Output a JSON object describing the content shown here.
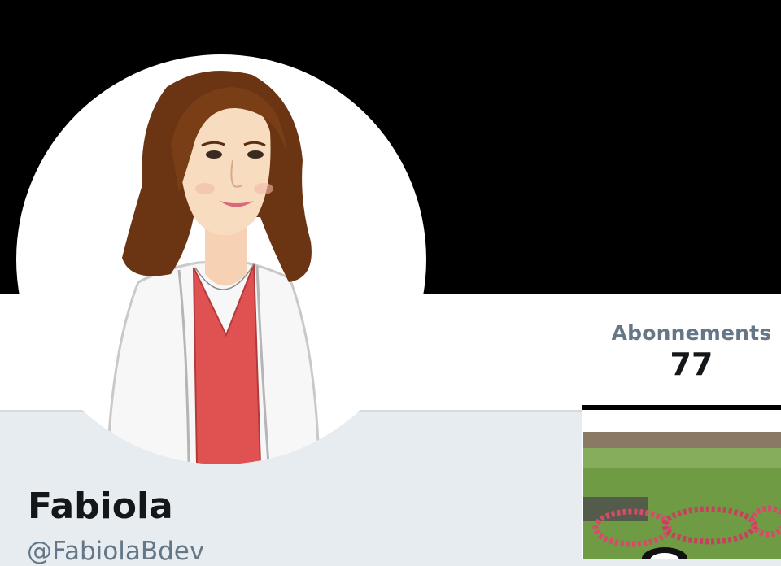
{
  "profile": {
    "name": "Fabiola",
    "screen_name": "@FabiolaBdev",
    "avatar_icon": "cartoon-woman-avatar",
    "banner_color": "#000000"
  },
  "stats": {
    "following": {
      "label": "Abonnements",
      "value": "77"
    }
  },
  "colors": {
    "label_gray": "#657786",
    "text_dark": "#14171a",
    "background": "#e6ecf0"
  },
  "media": {
    "thumbnail_icon": "photo-thumbnail"
  }
}
